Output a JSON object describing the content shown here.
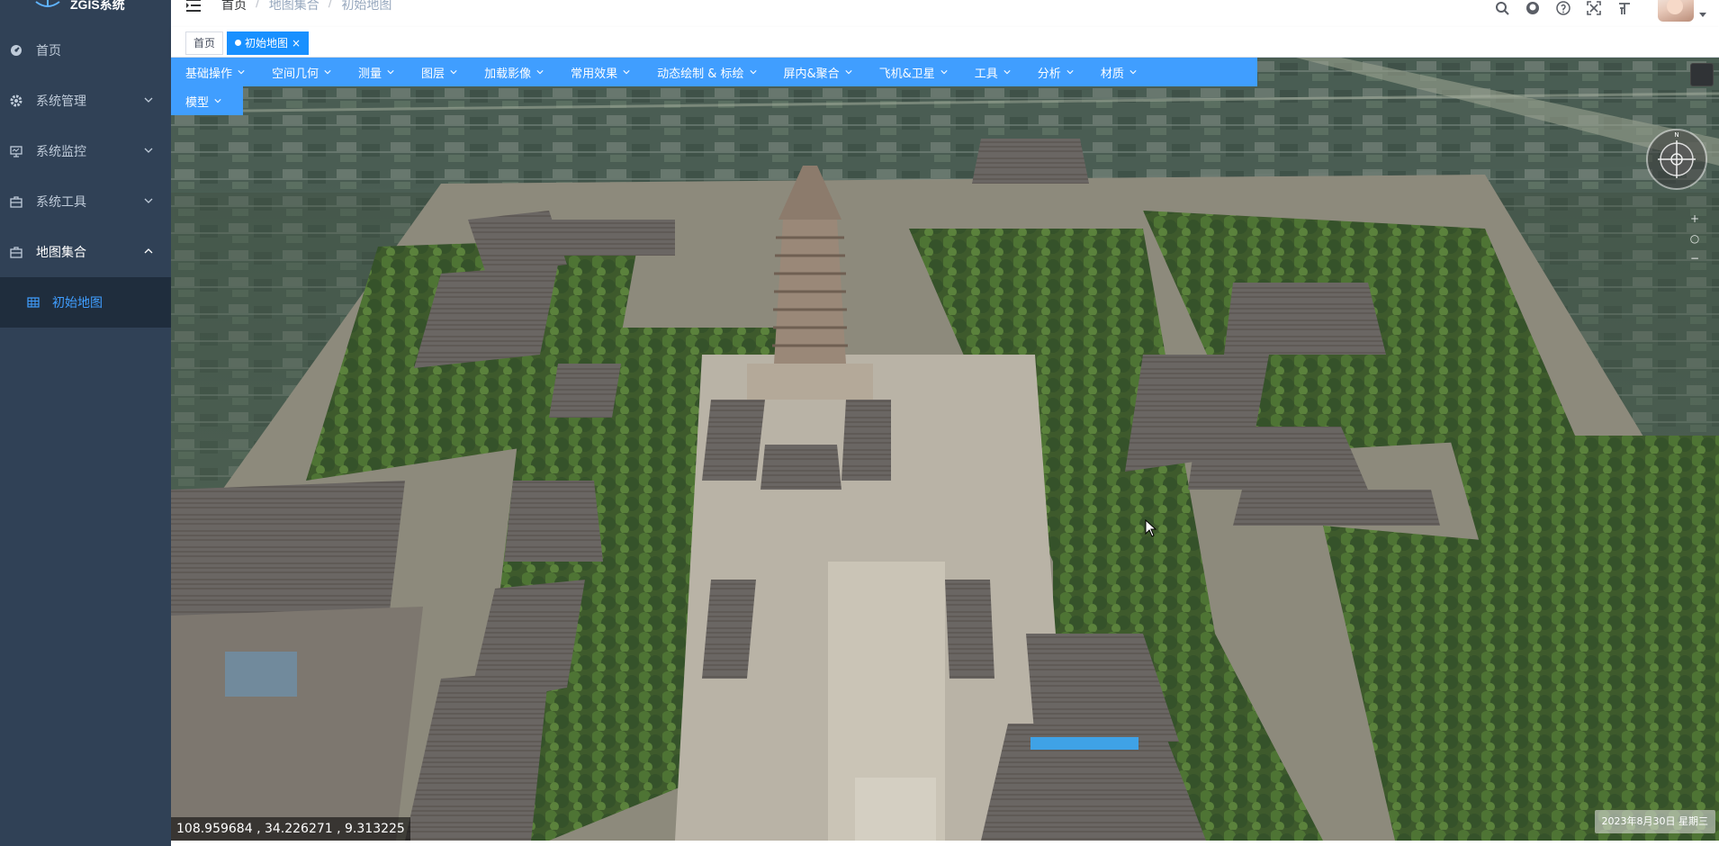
{
  "app": {
    "logo_text": "ZGIS系统"
  },
  "sidebar": {
    "items": [
      {
        "label": "首页",
        "icon": "dashboard-icon"
      },
      {
        "label": "系统管理",
        "icon": "gear-icon"
      },
      {
        "label": "系统监控",
        "icon": "monitor-icon"
      },
      {
        "label": "系统工具",
        "icon": "toolbox-icon"
      },
      {
        "label": "地图集合",
        "icon": "toolbox-icon"
      }
    ],
    "sub_items": [
      {
        "label": "初始地图",
        "icon": "grid-icon"
      }
    ]
  },
  "navbar": {
    "breadcrumb": [
      "首页",
      "地图集合",
      "初始地图"
    ],
    "separator": "/"
  },
  "tags": {
    "home": "首页",
    "active": "初始地图",
    "close": "×"
  },
  "toolbar": {
    "row1": [
      "基础操作",
      "空间几何",
      "测量",
      "图层",
      "加载影像",
      "常用效果",
      "动态绘制 & 标绘",
      "屏内&聚合",
      "飞机&卫星",
      "工具",
      "分析",
      "材质"
    ],
    "row2": [
      "模型"
    ]
  },
  "map": {
    "coords": "108.959684 ,   34.226271 ,   9.313225",
    "datetime": "2023年8月30日 星期三",
    "zoom_in": "+",
    "zoom_reset": "○",
    "zoom_out": "−",
    "compass_north": "N"
  },
  "colors": {
    "sidebar": "#304156",
    "accent": "#409eff",
    "submenu": "#1f2d3d"
  }
}
